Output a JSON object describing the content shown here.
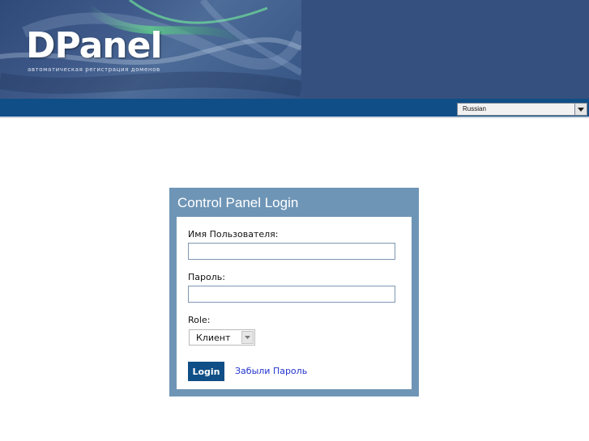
{
  "header": {
    "logo_text": "DPanel",
    "tagline": "автоматическая регистрация доменов"
  },
  "language": {
    "selected": "Russian",
    "arrow_icon": "chevron-down-icon"
  },
  "login": {
    "title": "Control Panel Login",
    "username_label": "Имя Пользователя:",
    "username_value": "",
    "password_label": "Пароль:",
    "password_value": "",
    "role_label": "Role:",
    "role_selected": "Клиент",
    "submit_label": "Login",
    "forgot_label": "Забыли Пароль"
  },
  "colors": {
    "header_bg": "#35507f",
    "lang_bar": "#0f4e86",
    "panel_frame": "#6e95b6",
    "button_bg": "#0f4e86",
    "link": "#2233cc"
  }
}
